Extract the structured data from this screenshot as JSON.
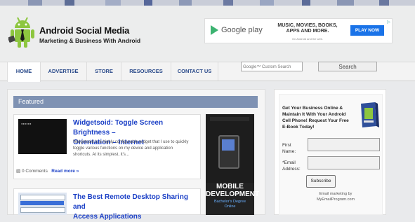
{
  "site": {
    "title": "Android Social Media",
    "tagline": "Marketing & Business With Android"
  },
  "ad": {
    "store": "Google play",
    "headline_line1": "MUSIC, MOVIES, BOOKS,",
    "headline_line2": "APPS AND MORE.",
    "subtext": "On Android and the web.",
    "button": "PLAY NOW"
  },
  "nav": {
    "items": [
      "HOME",
      "ADVERTISE",
      "STORE",
      "RESOURCES",
      "CONTACT US"
    ]
  },
  "search": {
    "placeholder": "Google™ Custom Search",
    "button": "Search"
  },
  "main": {
    "section_title": "Featured",
    "posts": [
      {
        "title_line1": "Widgetsoid: Toggle Screen Brightness –",
        "title_line2": "Orientation – Internet",
        "excerpt_line1": "Widgetsoid is a highly configurable widget that I use to quickly",
        "excerpt_line2": "toggle various functions on my device and application",
        "excerpt_line3": "shortcuts. At its simplest, it's...",
        "comments": "0 Comments",
        "read_more": "Read more »"
      },
      {
        "title_line1": "The Best Remote Desktop Sharing and",
        "title_line2": "Access Applications"
      }
    ],
    "side_ad": {
      "line1": "MOBILE",
      "line2": "DEVELOPMENT",
      "line3": "Bachelor's Degree",
      "line4": "Online"
    }
  },
  "sidebar": {
    "heading_line1": "Get Your Business Online &",
    "heading_line2": "Maintain It With Your Android",
    "heading_line3": "Cell Phone! Request Your Free",
    "heading_line4": "E-Book Today!",
    "first_name_label_1": "First",
    "first_name_label_2": "Name:",
    "email_label_1": "*Email",
    "email_label_2": "Address:",
    "subscribe": "Subscribe",
    "email_note_line1": "Email marketing by",
    "email_note_line2": "MyEmailProgram.com"
  },
  "colors": {
    "link": "#1a3fc6",
    "nav": "#2a4a8a",
    "featured_bar": "#7f92b3",
    "android_green": "#8dc63f"
  }
}
